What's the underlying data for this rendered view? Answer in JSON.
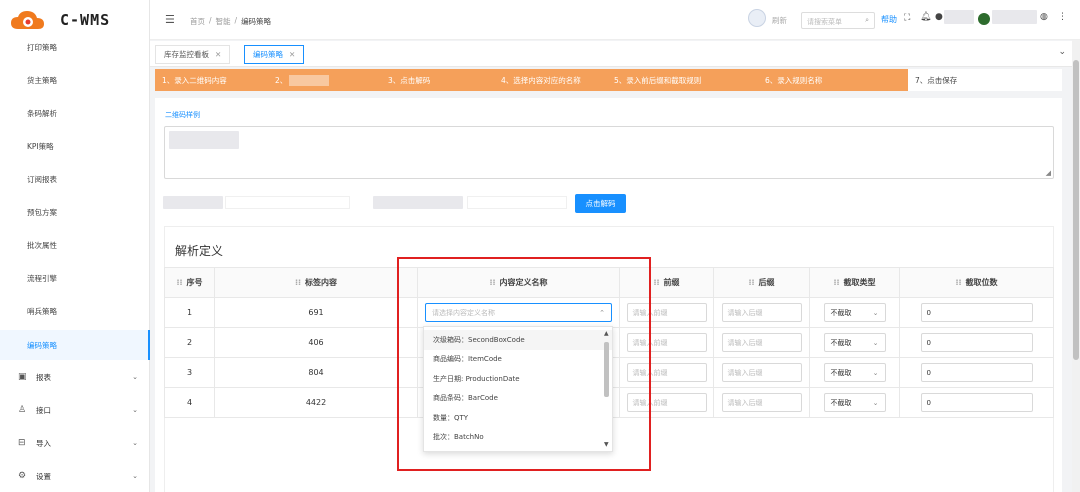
{
  "app": {
    "logo_text": "C-WMS"
  },
  "sidebar": {
    "items": [
      {
        "label": "打印策略"
      },
      {
        "label": "货主策略"
      },
      {
        "label": "条码解析"
      },
      {
        "label": "KPI策略"
      },
      {
        "label": "订阅报表"
      },
      {
        "label": "预包方案"
      },
      {
        "label": "批次属性"
      },
      {
        "label": "流程引擎"
      },
      {
        "label": "哨兵策略"
      },
      {
        "label": "编码策略"
      }
    ],
    "groups": [
      {
        "label": "报表",
        "icon": "report-icon"
      },
      {
        "label": "接口",
        "icon": "interface-icon"
      },
      {
        "label": "导入",
        "icon": "import-icon"
      },
      {
        "label": "设置",
        "icon": "settings-icon"
      }
    ]
  },
  "header": {
    "breadcrumb": [
      "首页",
      "智能",
      "编码策略"
    ],
    "refresh_label": "刷新",
    "menu_search_placeholder": "请搜索菜单",
    "help_label": "帮助"
  },
  "tabs": [
    {
      "label": "库存监控看板"
    },
    {
      "label": "编码策略"
    }
  ],
  "steps": [
    {
      "label": "1、录入二维码内容"
    },
    {
      "label": "2、"
    },
    {
      "label": "3、点击解码"
    },
    {
      "label": "4、选择内容对应的名称"
    },
    {
      "label": "5、录入前后缀和截取规则"
    },
    {
      "label": "6、录入规则名称"
    },
    {
      "label": "7、点击保存"
    }
  ],
  "form": {
    "sample_label": "二维码样例",
    "decode_button": "点击解码"
  },
  "section": {
    "title": "解析定义"
  },
  "table": {
    "headers": [
      "序号",
      "标签内容",
      "内容定义名称",
      "前缀",
      "后缀",
      "截取类型",
      "截取位数"
    ],
    "rows": [
      {
        "index": "1",
        "content": "691"
      },
      {
        "index": "2",
        "content": "406"
      },
      {
        "index": "3",
        "content": "804"
      },
      {
        "index": "4",
        "content": "4422"
      }
    ],
    "name_placeholder": "请选择内容定义名称",
    "prefix_placeholder": "请输入前缀",
    "suffix_placeholder": "请输入后缀",
    "cut_type_value": "不截取",
    "cut_count_value": "0"
  },
  "dropdown": {
    "options": [
      {
        "label": "次级箱码：SecondBoxCode"
      },
      {
        "label": "商品编码：ItemCode"
      },
      {
        "label": "生产日期: ProductionDate"
      },
      {
        "label": "商品条码：BarCode"
      },
      {
        "label": "数量：QTY"
      },
      {
        "label": "批次：BatchNo"
      }
    ]
  },
  "colors": {
    "accent": "#1890ff",
    "steps_bg": "#f5a05a",
    "highlight": "#e02020"
  }
}
